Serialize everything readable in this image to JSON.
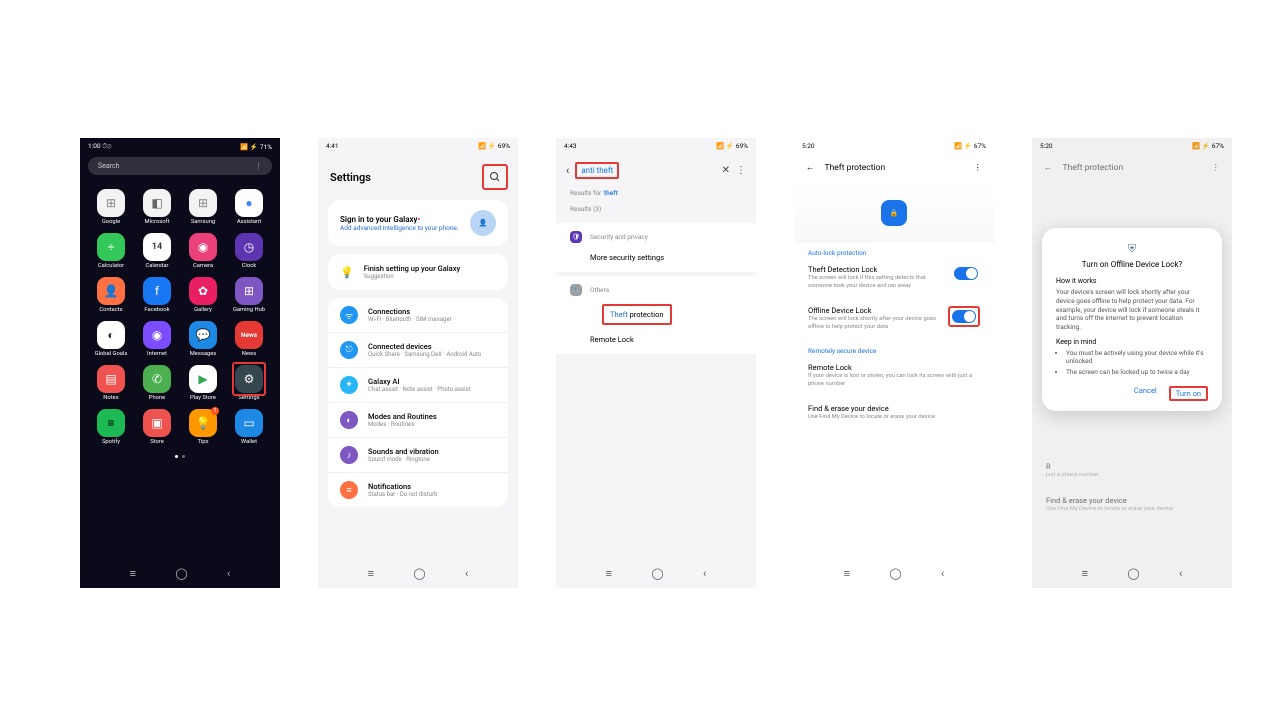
{
  "s1": {
    "time": "1:00",
    "clock_icons": "⏱⊘",
    "battery": "71%",
    "search_placeholder": "Search",
    "apps": [
      {
        "label": "Google",
        "bg": "#f3f3f3",
        "glyph": "⊞",
        "fg": "#888"
      },
      {
        "label": "Microsoft",
        "bg": "#f3f3f3",
        "glyph": "◧",
        "fg": "#666"
      },
      {
        "label": "Samsung",
        "bg": "#f3f3f3",
        "glyph": "⊞",
        "fg": "#888"
      },
      {
        "label": "Assistant",
        "bg": "#fff",
        "glyph": "●",
        "fg": "#4285f4"
      },
      {
        "label": "Calculator",
        "bg": "#34c759",
        "glyph": "÷",
        "fg": "#fff"
      },
      {
        "label": "Calendar",
        "bg": "#fff",
        "glyph": "14",
        "fg": "#333"
      },
      {
        "label": "Camera",
        "bg": "#ec407a",
        "glyph": "◉",
        "fg": "#fff"
      },
      {
        "label": "Clock",
        "bg": "#5e35b1",
        "glyph": "◷",
        "fg": "#fff"
      },
      {
        "label": "Contacts",
        "bg": "#ff7043",
        "glyph": "👤",
        "fg": "#fff"
      },
      {
        "label": "Facebook",
        "bg": "#1877f2",
        "glyph": "f",
        "fg": "#fff"
      },
      {
        "label": "Gallery",
        "bg": "#e91e63",
        "glyph": "✿",
        "fg": "#fff"
      },
      {
        "label": "Gaming Hub",
        "bg": "#7e57c2",
        "glyph": "⊞",
        "fg": "#fff"
      },
      {
        "label": "Global Goals",
        "bg": "#fff",
        "glyph": "◐",
        "fg": "#333"
      },
      {
        "label": "Internet",
        "bg": "#7c4dff",
        "glyph": "◉",
        "fg": "#fff"
      },
      {
        "label": "Messages",
        "bg": "#1e88e5",
        "glyph": "💬",
        "fg": "#fff"
      },
      {
        "label": "News",
        "bg": "#e53935",
        "glyph": "N",
        "fg": "#fff"
      },
      {
        "label": "Notes",
        "bg": "#ef5350",
        "glyph": "▤",
        "fg": "#fff"
      },
      {
        "label": "Phone",
        "bg": "#4caf50",
        "glyph": "✆",
        "fg": "#fff"
      },
      {
        "label": "Play Store",
        "bg": "#fff",
        "glyph": "▶",
        "fg": "#34a853"
      },
      {
        "label": "Settings",
        "bg": "#37474f",
        "glyph": "⚙",
        "fg": "#fff",
        "hl": true
      },
      {
        "label": "Spotify",
        "bg": "#1db954",
        "glyph": "≡",
        "fg": "#000"
      },
      {
        "label": "Store",
        "bg": "#ef5350",
        "glyph": "▣",
        "fg": "#fff"
      },
      {
        "label": "Tips",
        "bg": "#ff9800",
        "glyph": "💡",
        "fg": "#fff"
      },
      {
        "label": "Wallet",
        "bg": "#1e88e5",
        "glyph": "▭",
        "fg": "#fff"
      }
    ]
  },
  "s2": {
    "time": "4:41",
    "battery": "69%",
    "title": "Settings",
    "signin_title": "Sign in to your Galaxy",
    "signin_sub": "Add advanced intelligence to your phone.",
    "setup_title": "Finish setting up your Galaxy",
    "setup_sub": "Suggestion",
    "rows": [
      {
        "c": "#2196f3",
        "g": "ᯤ",
        "t": "Connections",
        "s": "Wi-Fi · Bluetooth · SIM manager"
      },
      {
        "c": "#2196f3",
        "g": "⎋",
        "t": "Connected devices",
        "s": "Quick Share · Samsung DeX · Android Auto"
      },
      {
        "c": "#29b6f6",
        "g": "✦",
        "t": "Galaxy AI",
        "s": "Chat assist · Note assist · Photo assist"
      },
      {
        "c": "#7e57c2",
        "g": "◐",
        "t": "Modes and Routines",
        "s": "Modes · Routines"
      },
      {
        "c": "#7e57c2",
        "g": "♪",
        "t": "Sounds and vibration",
        "s": "Sound mode · Ringtone"
      },
      {
        "c": "#ff7043",
        "g": "≡",
        "t": "Notifications",
        "s": "Status bar · Do not disturb"
      }
    ]
  },
  "s3": {
    "time": "4:43",
    "battery": "69%",
    "term": "anti theft",
    "results_for_prefix": "Results for '",
    "results_for_term": "theft",
    "results_for_suffix": "'",
    "results_count": "Results (3)",
    "cat1": "Security and privacy",
    "line1": "More security settings",
    "cat2": "Others",
    "line2a_pre": "Theft",
    "line2a_post": " protection",
    "line2b": "Remote Lock"
  },
  "s4": {
    "time": "5:20",
    "battery": "67%",
    "title": "Theft protection",
    "section1": "Auto-lock protection",
    "r1t": "Theft Detection Lock",
    "r1d": "The screen will lock if this setting detects that someone took your device and ran away",
    "r2t": "Offline Device Lock",
    "r2d": "The screen will lock shortly after your device goes offline to help protect your data",
    "section2": "Remotely secure device",
    "r3t": "Remote Lock",
    "r3d": "If your device is lost or stolen, you can lock its screen with just a phone number",
    "r4t": "Find & erase your device",
    "r4d": "Use Find My Device to locate or erase your device"
  },
  "s5": {
    "time": "5:20",
    "battery": "67%",
    "title": "Theft protection",
    "bg_r3t": "R",
    "bg_r4t": "Find & erase your device",
    "bg_r4d": "Use Find My Device to locate or erase your device",
    "dlg_title": "Turn on Offline Device Lock?",
    "dlg_h1": "How it works",
    "dlg_body": "Your device's screen will lock shortly after your device goes offline to help protect your data. For example, your device will lock if someone steals it and turns off the internet to prevent location tracking.",
    "dlg_h2": "Keep in mind",
    "dlg_li1": "You must be actively using your device while it's unlocked",
    "dlg_li2": "The screen can be locked up to twice a day",
    "cancel": "Cancel",
    "turnon": "Turn on"
  }
}
